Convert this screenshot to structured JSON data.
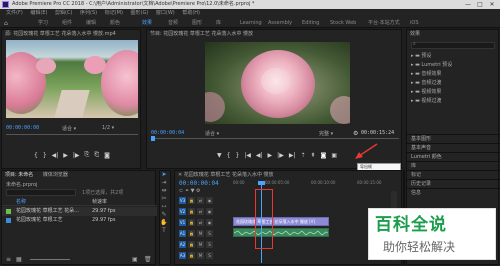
{
  "window": {
    "title": "Adobe Premiere Pro CC 2018 - C:\\用户\\Administrator\\文档\\Adobe\\Premiere Pro\\12.0\\未命名.prproj *",
    "min": "—",
    "max": "□",
    "close": "✕"
  },
  "menu": [
    "文件(F)",
    "编辑(E)",
    "剪辑(C)",
    "序列(S)",
    "标记(M)",
    "图形(G)",
    "窗口(W)",
    "帮助(H)"
  ],
  "workspaces": [
    "学习",
    "组件",
    "编辑",
    "颜色",
    "效果",
    "音频",
    "图形",
    "库",
    "Learning",
    "Assembly",
    "Editing",
    "Color",
    "Effects",
    "Audio (CS6)",
    "Graphics",
    "Libraries",
    "Stock Web",
    "平台·本站方式",
    "iOS"
  ],
  "active_workspace": "效果",
  "source": {
    "tab": "源: 花园玫瑰花 草根工艺 花朵落入水中 慢放.mp4",
    "timecode": "00:00:00:00",
    "fit": "适合",
    "ratio": "1/2"
  },
  "program": {
    "tab": "节目: 花园玫瑰花 草根工艺 花朵落入水中 慢放",
    "timecode": "00:00:00:04",
    "fit": "适合",
    "quality": "完整",
    "duration": "00:00:15:24"
  },
  "project": {
    "tab": "项目: 未命名",
    "tab2": "媒体浏览器",
    "file": "未命名.prproj",
    "count": "1项已选择，共2项",
    "col_name": "名称",
    "col_fps": "帧速率",
    "items": [
      {
        "name": "花园玫瑰花 草根工艺 花朵...",
        "fps": "29.97 fps"
      },
      {
        "name": "花园玫瑰花 草根工艺",
        "fps": "29.97 fps"
      }
    ]
  },
  "sequence": {
    "tab": "花园玫瑰花 草根工艺 花朵落入水中 慢放",
    "timecode": "00:00:00:04",
    "ruler": [
      "00:00",
      "00:00:05:00",
      "00:00:10:00",
      "00:00:15:00"
    ],
    "tracks": [
      "V3",
      "V2",
      "V1",
      "A1",
      "A2",
      "A3"
    ],
    "clip_label": "花园玫瑰花 草根工艺 花朵落入水中 慢放 [V]",
    "tooltip": "导出帧 (Ctrl+Shift+E)"
  },
  "effects": {
    "tab": "效果",
    "items": [
      "预设",
      "Lumetri 预设",
      "音频效果",
      "音频过渡",
      "视频效果",
      "视频过渡"
    ],
    "sections": [
      "基本图形",
      "基本声音",
      "Lumetri 颜色",
      "库",
      "标记",
      "历史记录",
      "信息"
    ]
  },
  "watermark": {
    "big": "百科全说",
    "small": "助你轻松解决"
  },
  "colors": {
    "accent": "#4aa4ff",
    "clip_video": "#8d8bd6",
    "clip_audio": "#3a8a5d",
    "highlight": "#e53935"
  }
}
